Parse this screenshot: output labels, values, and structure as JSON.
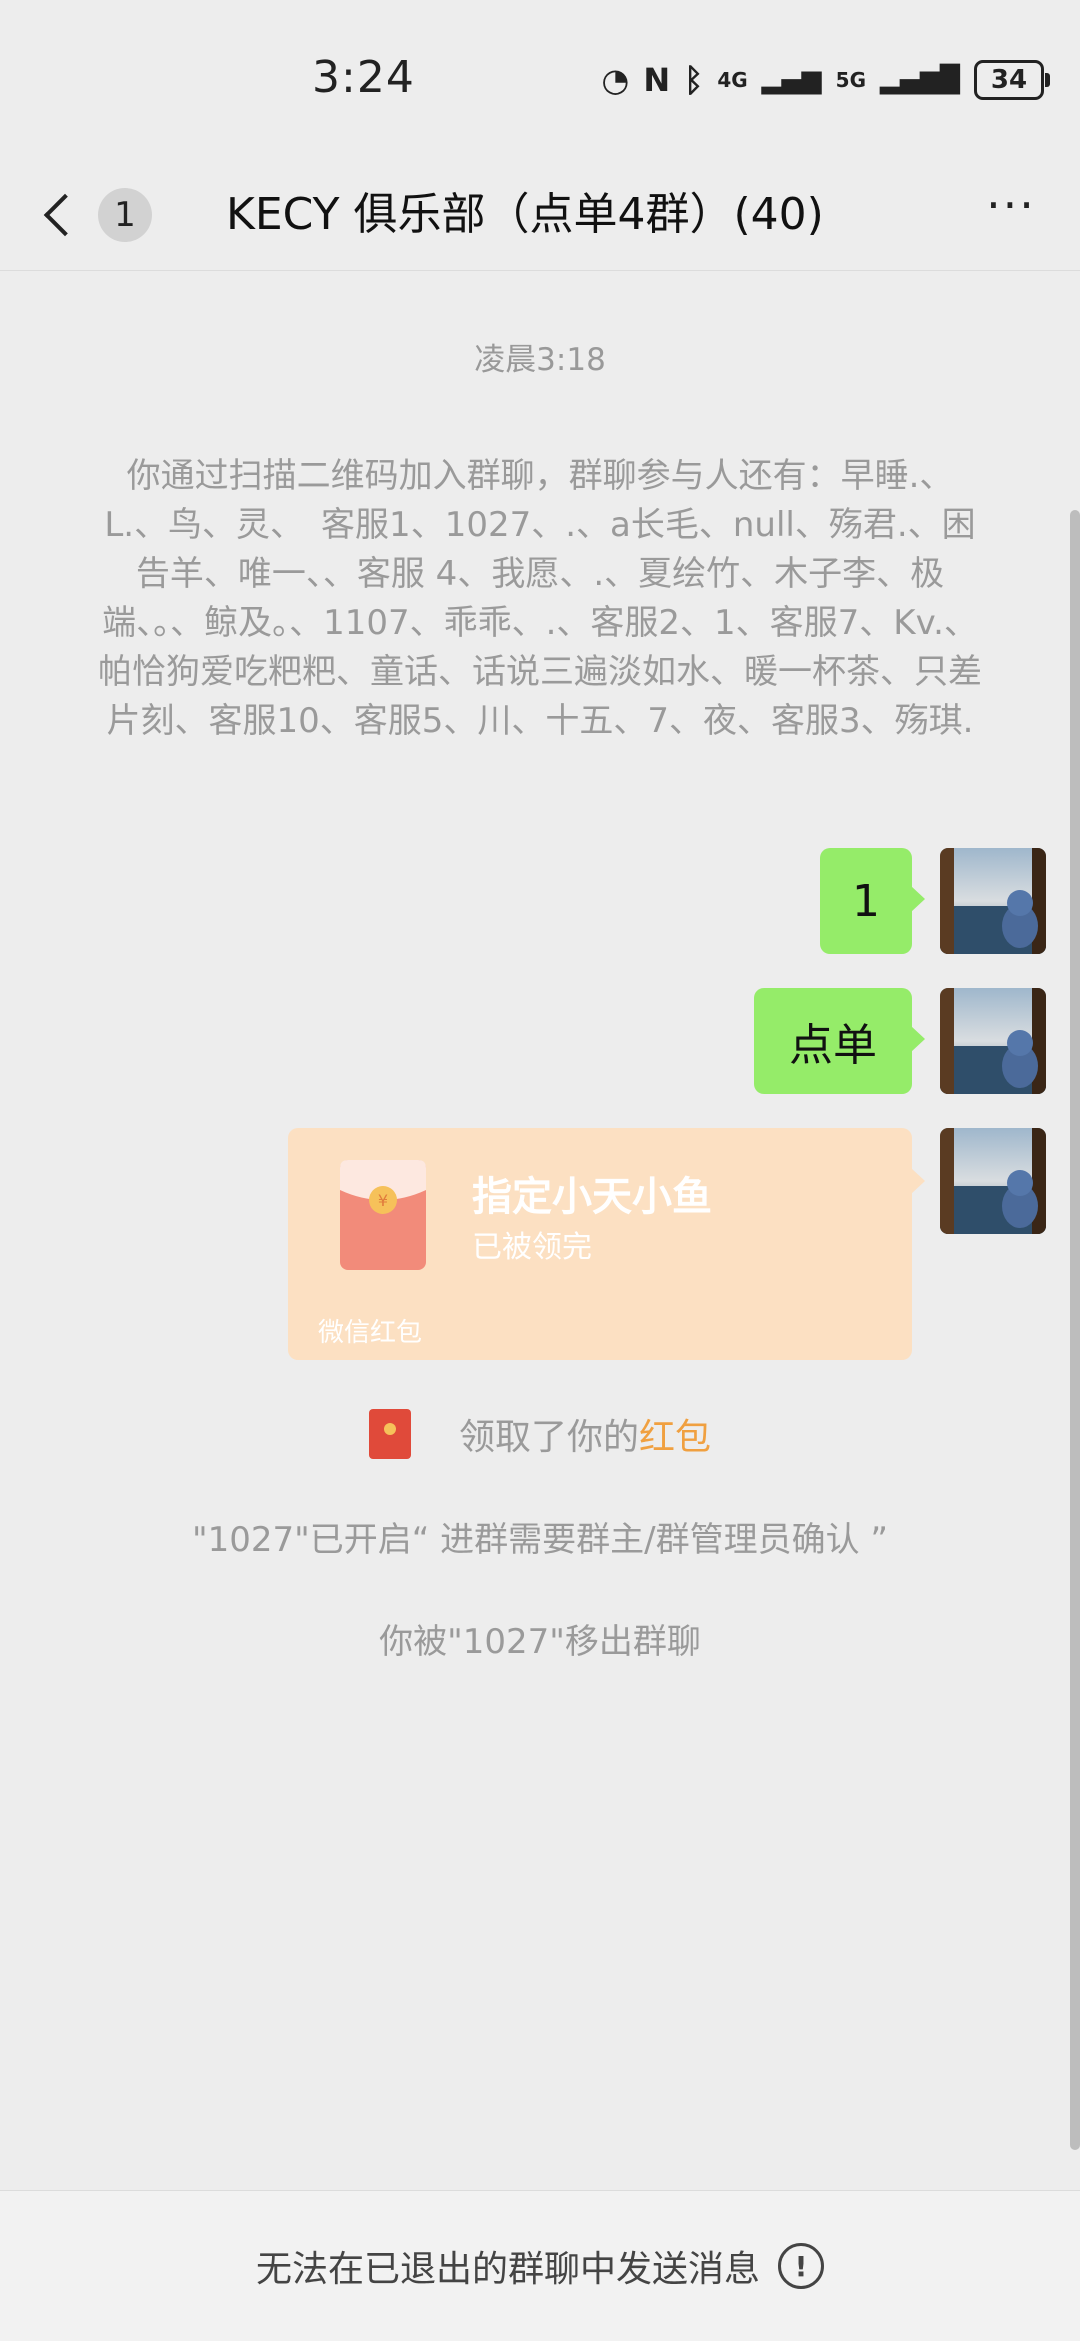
{
  "status_bar": {
    "time": "3:24",
    "network_label": "4G",
    "network2_label": "5G",
    "battery": "34"
  },
  "nav": {
    "unread_count": "1",
    "title": "KECY  俱乐部（点单4群）(40)",
    "more_label": "···"
  },
  "chat": {
    "timestamp": "凌晨3:18",
    "join_notice": "你通过扫描二维码加入群聊，群聊参与人还有：早睡.、L.、鸟、灵、　客服1、1027、.、a长毛、null、殇君.、困告羊、唯一、、客服 4、我愿、.、夏绘竹、木子李、极端、。、鲸及。、1107、乖乖、.、客服2、1、客服7、Kv.、帕恰狗爱吃粑粑、童话、话说三遍淡如水、暖一杯茶、只差片刻、客服10、客服5、川、十五、7、夜、客服3、殇琪.",
    "messages": [
      {
        "text": "1"
      },
      {
        "text": "点单"
      }
    ],
    "red_packet": {
      "title": "指定小天小鱼",
      "status": "已被领完",
      "footer": "微信红包"
    },
    "claim_prefix": "领取了你的",
    "claim_link": "红包",
    "approval_notice": "\"1027\"已开启“ 进群需要群主/群管理员确认 ”",
    "removed_notice": "你被\"1027\"移出群聊"
  },
  "footer": {
    "text": "无法在已退出的群聊中发送消息",
    "info_icon_glyph": "!"
  },
  "colors": {
    "background": "#ededed",
    "bubble": "#95ec69",
    "red_packet_bg": "#fce0c2",
    "highlight": "#f0a040"
  }
}
